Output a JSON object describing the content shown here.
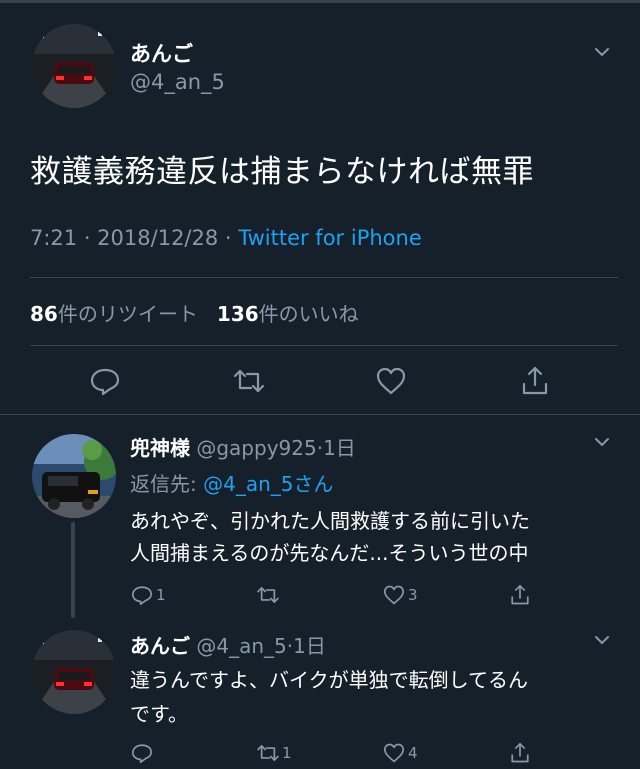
{
  "main": {
    "name": "あんご",
    "handle": "@4_an_5",
    "text": "救護義務違反は捕まらなければ無罪",
    "time": "7:21 · 2018/12/28 · ",
    "source": "Twitter for iPhone",
    "retweets_count": "86",
    "retweets_label": "件のリツイート",
    "likes_count": "136",
    "likes_label": "件のいいね"
  },
  "replies": [
    {
      "name": "兜神様",
      "handle": "@gappy925",
      "time": "·1日",
      "reply_to_label": "返信先: ",
      "reply_to_user": "@4_an_5さん",
      "lines": [
        "あれやぞ、引かれた人間救護する前に引いた",
        "人間捕まえるのが先なんだ...そういう世の中"
      ],
      "reply_count": "1",
      "retweet_count": "",
      "like_count": "3"
    },
    {
      "name": "あんご",
      "handle": "@4_an_5",
      "time": "·1日",
      "lines": [
        "違うんですよ、バイクが単独で転倒してるん",
        "です。"
      ],
      "reply_count": "",
      "retweet_count": "1",
      "like_count": "4"
    }
  ],
  "colors": {
    "background": "#15202b",
    "muted": "#8899a6",
    "link": "#1da1f2",
    "divider": "#38444d"
  },
  "icons": [
    "chevron-down-icon",
    "reply-icon",
    "retweet-icon",
    "like-icon",
    "share-icon"
  ]
}
